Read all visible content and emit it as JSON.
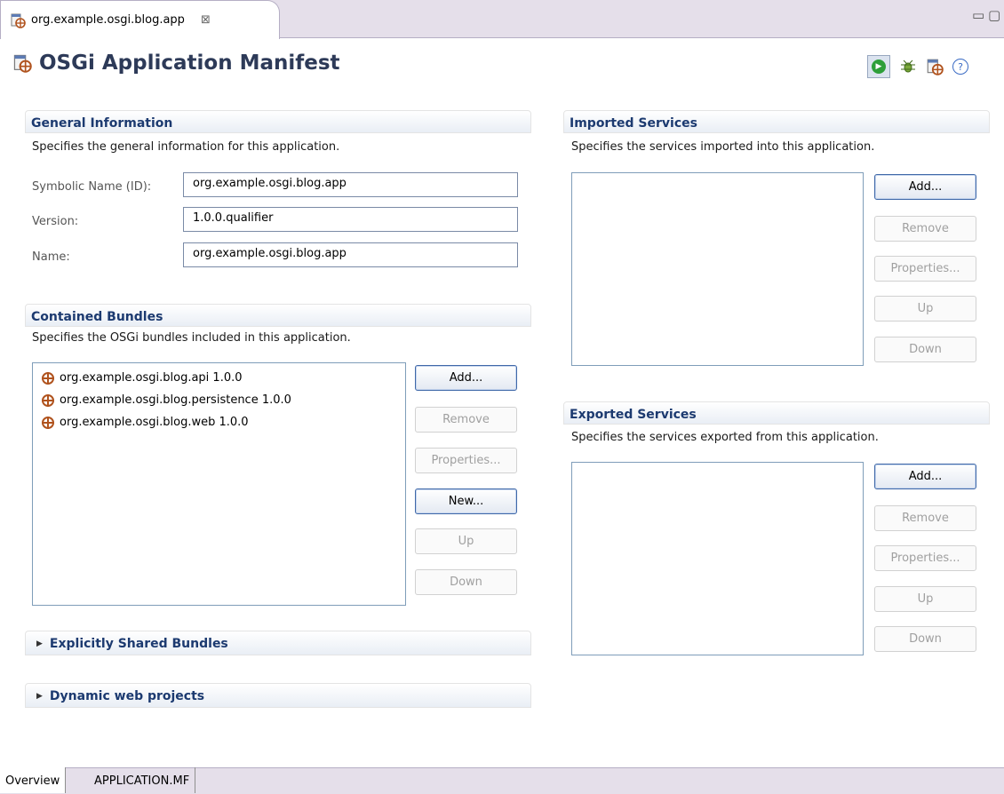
{
  "editor_tab": {
    "title": "org.example.osgi.blog.app",
    "close_glyph": "⊠"
  },
  "window_controls": {
    "minimize": "▭",
    "maximize": "▢"
  },
  "header": {
    "title": "OSGi Application Manifest",
    "run_glyph": "▶",
    "help_glyph": "?"
  },
  "general": {
    "title": "General Information",
    "description": "Specifies the general information for this application.",
    "fields": [
      {
        "label": "Symbolic Name (ID):",
        "value": "org.example.osgi.blog.app"
      },
      {
        "label": "Version:",
        "value": "1.0.0.qualifier"
      },
      {
        "label": "Name:",
        "value": "org.example.osgi.blog.app"
      }
    ]
  },
  "bundles": {
    "title": "Contained Bundles",
    "description": "Specifies the OSGi bundles included in this application.",
    "items": [
      "org.example.osgi.blog.api 1.0.0",
      "org.example.osgi.blog.persistence 1.0.0",
      "org.example.osgi.blog.web 1.0.0"
    ],
    "buttons": {
      "add": "Add...",
      "remove": "Remove",
      "properties": "Properties...",
      "new": "New...",
      "up": "Up",
      "down": "Down"
    }
  },
  "shared": {
    "title": "Explicitly Shared Bundles"
  },
  "webprojects": {
    "title": "Dynamic web projects"
  },
  "imported": {
    "title": "Imported Services",
    "description": "Specifies the services imported into this application.",
    "buttons": {
      "add": "Add...",
      "remove": "Remove",
      "properties": "Properties...",
      "up": "Up",
      "down": "Down"
    }
  },
  "exported": {
    "title": "Exported Services",
    "description": "Specifies the services exported from this application.",
    "buttons": {
      "add": "Add...",
      "remove": "Remove",
      "properties": "Properties...",
      "up": "Up",
      "down": "Down"
    }
  },
  "page_tabs": [
    "Overview",
    "APPLICATION.MF"
  ],
  "triangle_glyph": "▶"
}
